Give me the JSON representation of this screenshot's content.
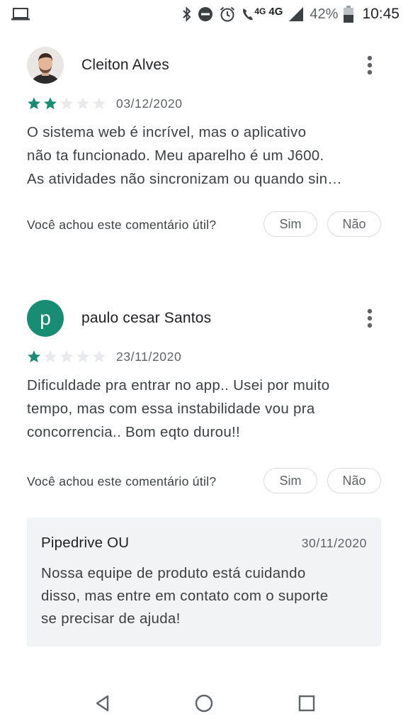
{
  "status_bar": {
    "network_small": "4G",
    "network_big": "4G",
    "battery": "42%",
    "time": "10:45",
    "icons": [
      "laptop-icon",
      "bluetooth-icon",
      "do-not-disturb-icon",
      "alarm-icon",
      "volte-call-icon",
      "signal-icon",
      "battery-icon"
    ]
  },
  "reviews": [
    {
      "author": "Cleiton Alves",
      "avatar": "photo",
      "rating": 2,
      "max_rating": 5,
      "date": "03/12/2020",
      "text_lines": [
        "O sistema web é incrível, mas o aplicativo",
        "não ta funcionado. Meu aparelho é um J600.",
        "As atividades não sincronizam ou quando sin…"
      ],
      "helpful_question": "Você achou este comentário útil?",
      "yes_label": "Sim",
      "no_label": "Não"
    },
    {
      "author": "paulo cesar Santos",
      "avatar_letter": "p",
      "rating": 1,
      "max_rating": 5,
      "date": "23/11/2020",
      "text_lines": [
        "Dificuldade pra entrar no app.. Usei por muito",
        "tempo, mas com essa instabilidade vou pra",
        "concorrencia.. Bom eqto durou!!"
      ],
      "helpful_question": "Você achou este comentário útil?",
      "yes_label": "Sim",
      "no_label": "Não"
    }
  ],
  "developer_reply": {
    "name": "Pipedrive OU",
    "date": "30/11/2020",
    "text_lines": [
      "Nossa equipe de produto está cuidando",
      "disso, mas entre em contato com o suporte",
      "se precisar de ajuda!"
    ]
  },
  "colors": {
    "star_filled": "#188d73",
    "star_empty": "#e8eaed",
    "avatar_letter_bg": "#188d73",
    "reply_bg": "#f1f3f4"
  },
  "nav_bar": {
    "icons": [
      "back-icon",
      "home-icon",
      "recents-icon"
    ]
  }
}
